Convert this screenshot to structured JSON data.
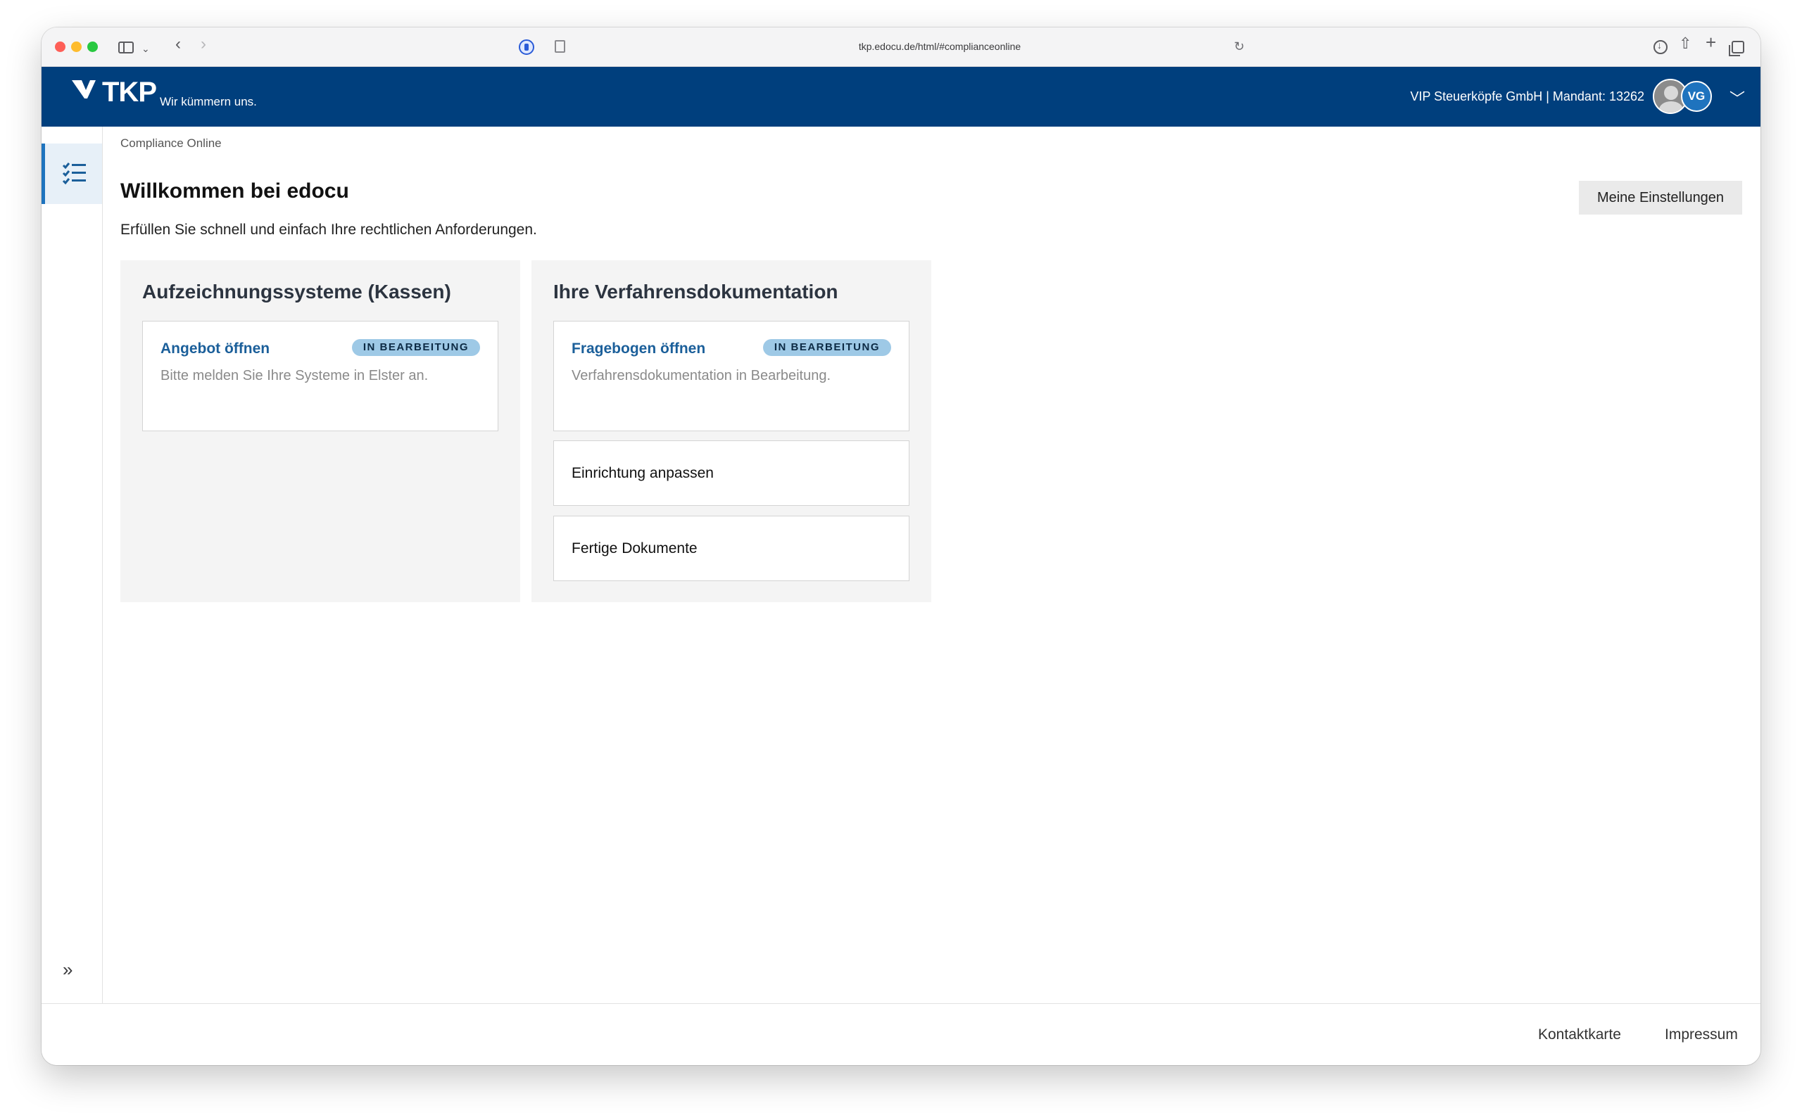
{
  "browser": {
    "url": "tkp.edocu.de/html/#complianceonline"
  },
  "header": {
    "logo_text": "TKP",
    "logo_claim": "Wir kümmern uns.",
    "tenant": "VIP Steuerköpfe GmbH | Mandant: 13262",
    "avatar_initials": "VG",
    "brand_color": "#003f7d"
  },
  "breadcrumb": "Compliance Online",
  "main": {
    "title": "Willkommen bei edocu",
    "subtitle": "Erfüllen Sie schnell und einfach Ihre rechtlichen Anforderungen.",
    "settings_label": "Meine Einstellungen"
  },
  "panels": [
    {
      "title": "Aufzeichnungssysteme (Kassen)",
      "cards": [
        {
          "link": "Angebot öffnen",
          "badge": "IN BEARBEITUNG",
          "description": "Bitte melden Sie Ihre Systeme in Elster an."
        }
      ]
    },
    {
      "title": "Ihre Verfahrensdokumentation",
      "cards": [
        {
          "link": "Fragebogen öffnen",
          "badge": "IN BEARBEITUNG",
          "description": "Verfahrensdokumentation in Bearbeitung."
        },
        {
          "label": "Einrichtung anpassen"
        },
        {
          "label": "Fertige Dokumente"
        }
      ]
    }
  ],
  "footer": {
    "contact": "Kontaktkarte",
    "imprint": "Impressum"
  },
  "icons": {
    "nav_active": "checklist-icon",
    "nav_expand": "double-chevron-right-icon"
  }
}
